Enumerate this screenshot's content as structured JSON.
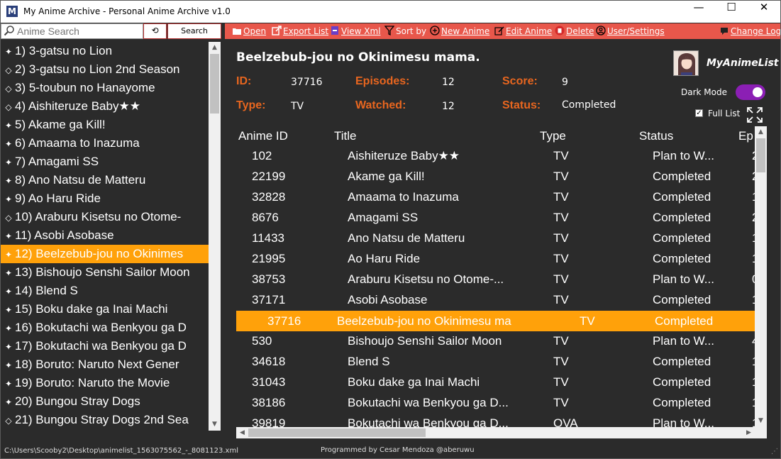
{
  "window": {
    "title": "My Anime Archive - Personal Anime Archive v1.0",
    "app_icon": "M",
    "minimize": "—",
    "maximize": "☐",
    "close": "✕"
  },
  "search": {
    "placeholder": "Anime Search",
    "clear_label": "⟲",
    "button_label": "Search"
  },
  "toolbar": {
    "open": "Open",
    "export": "Export List",
    "view_xml": "View Xml",
    "sort": "Sort by",
    "new_anime": "New Anime",
    "edit_anime": "Edit Anime",
    "delete": "Delete",
    "user_settings": "User/Settings",
    "change_log": "Change Log"
  },
  "anime_list": [
    {
      "glyph": "✦",
      "label": "1) 3-gatsu no Lion"
    },
    {
      "glyph": "◇",
      "label": "2) 3-gatsu no Lion 2nd Season"
    },
    {
      "glyph": "◇",
      "label": "3) 5-toubun no Hanayome"
    },
    {
      "glyph": "◇",
      "label": "4)  Aishiteruze Baby★★"
    },
    {
      "glyph": "✦",
      "label": "5) Akame ga Kill!"
    },
    {
      "glyph": "✦",
      "label": "6) Amaama to Inazuma"
    },
    {
      "glyph": "✦",
      "label": "7) Amagami SS"
    },
    {
      "glyph": "✦",
      "label": "8) Ano Natsu de Matteru"
    },
    {
      "glyph": "✦",
      "label": "9) Ao Haru Ride"
    },
    {
      "glyph": "◇",
      "label": "10) Araburu Kisetsu no Otome-"
    },
    {
      "glyph": "✦",
      "label": "11) Asobi Asobase"
    },
    {
      "glyph": "✦",
      "label": "12) Beelzebub-jou no Okinimes"
    },
    {
      "glyph": "✦",
      "label": "13) Bishoujo Senshi Sailor Moon"
    },
    {
      "glyph": "✦",
      "label": "14) Blend S"
    },
    {
      "glyph": "✦",
      "label": "15) Boku dake ga Inai Machi"
    },
    {
      "glyph": "✦",
      "label": "16) Bokutachi wa Benkyou ga D"
    },
    {
      "glyph": "✦",
      "label": "17) Bokutachi wa Benkyou ga D"
    },
    {
      "glyph": "✦",
      "label": "18) Boruto: Naruto Next Gener"
    },
    {
      "glyph": "✦",
      "label": "19) Boruto: Naruto the Movie"
    },
    {
      "glyph": "✦",
      "label": "20) Bungou Stray Dogs"
    },
    {
      "glyph": "◇",
      "label": "21) Bungou Stray Dogs 2nd Sea"
    }
  ],
  "selected_index": 11,
  "details": {
    "title": "Beelzebub-jou no Okinimesu mama.",
    "id_label": "ID:",
    "id_value": "37716",
    "episodes_label": "Episodes:",
    "episodes_value": "12",
    "score_label": "Score:",
    "score_value": "9",
    "type_label": "Type:",
    "type_value": "TV",
    "watched_label": "Watched:",
    "watched_value": "12",
    "status_label": "Status:",
    "status_value": "Completed"
  },
  "mal": {
    "logo_text": "MyAnimeList"
  },
  "settings": {
    "dark_mode_label": "Dark Mode",
    "dark_mode_on": true,
    "full_list_label": "Full List",
    "full_list_checked": true,
    "check_mark": "✓"
  },
  "grid": {
    "headers": [
      "Anime ID",
      "Title",
      "Type",
      "Status",
      "Ep"
    ],
    "rows": [
      {
        "id": "102",
        "title": "Aishiteruze Baby★★",
        "type": "TV",
        "status": "Plan to W...",
        "ep": "2"
      },
      {
        "id": "22199",
        "title": "Akame ga Kill!",
        "type": "TV",
        "status": "Completed",
        "ep": "2"
      },
      {
        "id": "32828",
        "title": "Amaama to Inazuma",
        "type": "TV",
        "status": "Completed",
        "ep": "1"
      },
      {
        "id": "8676",
        "title": "Amagami SS",
        "type": "TV",
        "status": "Completed",
        "ep": "2"
      },
      {
        "id": "11433",
        "title": "Ano Natsu de Matteru",
        "type": "TV",
        "status": "Completed",
        "ep": "1"
      },
      {
        "id": "21995",
        "title": "Ao Haru Ride",
        "type": "TV",
        "status": "Completed",
        "ep": "1"
      },
      {
        "id": "38753",
        "title": "Araburu Kisetsu no Otome-...",
        "type": "TV",
        "status": "Plan to W...",
        "ep": "0"
      },
      {
        "id": "37171",
        "title": "Asobi Asobase",
        "type": "TV",
        "status": "Completed",
        "ep": "1"
      },
      {
        "id": "37716",
        "title": "Beelzebub-jou  no  Okinimesu  ma",
        "type": "TV",
        "status": "Completed",
        "ep": ""
      },
      {
        "id": "530",
        "title": "Bishoujo Senshi Sailor Moon",
        "type": "TV",
        "status": "Plan to W...",
        "ep": "4"
      },
      {
        "id": "34618",
        "title": "Blend S",
        "type": "TV",
        "status": "Completed",
        "ep": "1"
      },
      {
        "id": "31043",
        "title": "Boku dake ga Inai Machi",
        "type": "TV",
        "status": "Completed",
        "ep": "1"
      },
      {
        "id": "38186",
        "title": "Bokutachi wa Benkyou ga D...",
        "type": "TV",
        "status": "Completed",
        "ep": "1"
      },
      {
        "id": "39819",
        "title": "Bokutachi wa Benkyou ga D...",
        "type": "OVA",
        "status": "Plan to W...",
        "ep": "1"
      }
    ],
    "selected_row": 8
  },
  "statusbar": {
    "path": "C:\\Users\\Scooby2\\Desktop\\animelist_1563075562_-_8081123.xml",
    "credit": "Programmed by Cesar Mendoza @aberuwu"
  },
  "colors": {
    "accent_orange": "#ffa10a",
    "label_orange": "#e8661f",
    "toolbar_red": "#e8574b",
    "toggle_purple": "#8b1fb4",
    "background": "#2b2b2b"
  }
}
